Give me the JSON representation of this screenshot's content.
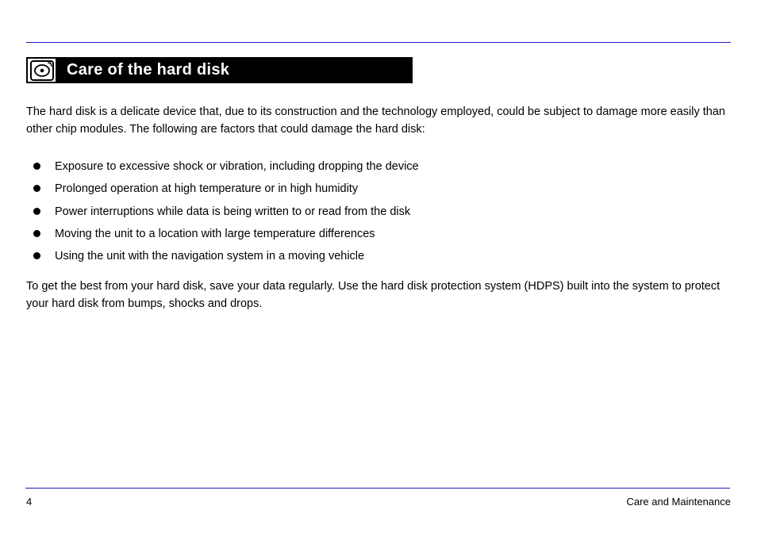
{
  "header": {
    "section_title": "Care of the hard disk"
  },
  "intro": {
    "p1": "The hard disk is a delicate device that, due to its construction and the technology employed, could be subject to damage more easily than other chip modules. The following are factors that could damage the hard disk:",
    "p2": "To get the best from your hard disk, save your data regularly. Use the hard disk protection system (HDPS) built into the system to protect your hard disk from bumps, shocks and drops."
  },
  "bullets": [
    "Exposure to excessive shock or vibration, including dropping the device",
    "Prolonged operation at high temperature or in high humidity",
    "Power interruptions while data is being written to or read from the disk",
    "Moving the unit to a location with large temperature differences",
    "Using the unit with the navigation system in a moving vehicle"
  ],
  "footer": {
    "left": "4",
    "right": "Care and Maintenance"
  }
}
